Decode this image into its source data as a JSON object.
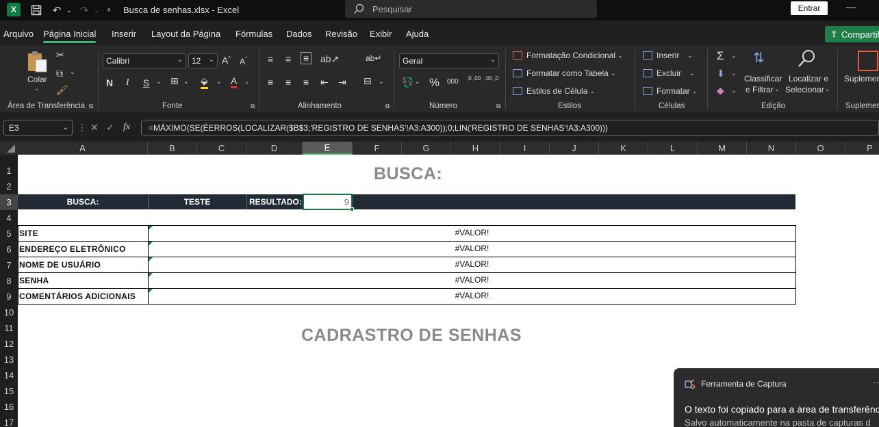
{
  "window": {
    "doc_title": "Busca de senhas.xlsx  -  Excel",
    "search_placeholder": "Pesquisar",
    "signin_label": "Entrar",
    "minimize": "—"
  },
  "menu": {
    "tabs": [
      "Arquivo",
      "Página Inicial",
      "Inserir",
      "Layout da Página",
      "Fórmulas",
      "Dados",
      "Revisão",
      "Exibir",
      "Ajuda"
    ],
    "active_tab": "Página Inicial",
    "share_label": "Compartil"
  },
  "ribbon": {
    "clipboard": {
      "paste_label": "Colar",
      "group_label": "Área de Transferência"
    },
    "font": {
      "font_name": "Calibri",
      "font_size": "12",
      "bold": "N",
      "italic": "I",
      "underline": "S",
      "group_label": "Fonte"
    },
    "alignment": {
      "group_label": "Alinhamento"
    },
    "number": {
      "format": "Geral",
      "percent": "%",
      "thousands": "000",
      "inc_dec": ",0 ,00",
      "dec_dec": ",00 ,0",
      "group_label": "Número"
    },
    "styles": {
      "conditional": "Formatação Condicional",
      "as_table": "Formatar como Tabela",
      "cell_styles": "Estilos de Célula",
      "group_label": "Estilos"
    },
    "cells": {
      "insert": "Inserir",
      "delete": "Excluir",
      "format": "Formatar",
      "group_label": "Células"
    },
    "editing": {
      "sort_l1": "Classificar",
      "sort_l2": "e Filtrar",
      "find_l1": "Localizar e",
      "find_l2": "Selecionar",
      "group_label": "Edição"
    },
    "addins": {
      "label": "Suplemen",
      "group_label": "Suplemen"
    }
  },
  "formula_bar": {
    "name_box": "E3",
    "fx": "fx",
    "formula": "=MÁXIMO(SE(ÉERROS(LOCALIZAR($B$3;'REGISTRO DE SENHAS'!A3:A300));0;LIN('REGISTRO DE SENHAS'!A3:A300)))"
  },
  "columns": [
    "A",
    "B",
    "C",
    "D",
    "E",
    "F",
    "G",
    "H",
    "I",
    "J",
    "K",
    "L",
    "M",
    "N",
    "O",
    "P"
  ],
  "selected_column": "E",
  "rows": [
    "1",
    "2",
    "3",
    "4",
    "5",
    "6",
    "7",
    "8",
    "9",
    "10",
    "11",
    "12",
    "13",
    "14",
    "15",
    "16",
    "17"
  ],
  "selected_row": "3",
  "sheet": {
    "title_busca": "BUSCA:",
    "busca_label": "BUSCA:",
    "busca_value": "TESTE",
    "resultado_label": "RESULTADO:",
    "resultado_value": "9",
    "fields": [
      {
        "label": "SITE",
        "value": "#VALOR!"
      },
      {
        "label": "ENDEREÇO ELETRÔNICO",
        "value": "#VALOR!"
      },
      {
        "label": "NOME DE USUÁRIO",
        "value": "#VALOR!"
      },
      {
        "label": "SENHA",
        "value": "#VALOR!"
      },
      {
        "label": "COMENTÁRIOS ADICIONAIS",
        "value": "#VALOR!"
      }
    ],
    "title_cadastro": "CADRASTRO DE SENHAS"
  },
  "toast": {
    "app_name": "Ferramenta de Captura",
    "message": "O texto foi copiado para a área de transferênc",
    "sub": "Salvo automaticamente na pasta de capturas d",
    "more": "···"
  },
  "colors": {
    "excel_green": "#107c41",
    "header_row_bg": "#222b35",
    "accent_tab": "#3fb56e"
  }
}
